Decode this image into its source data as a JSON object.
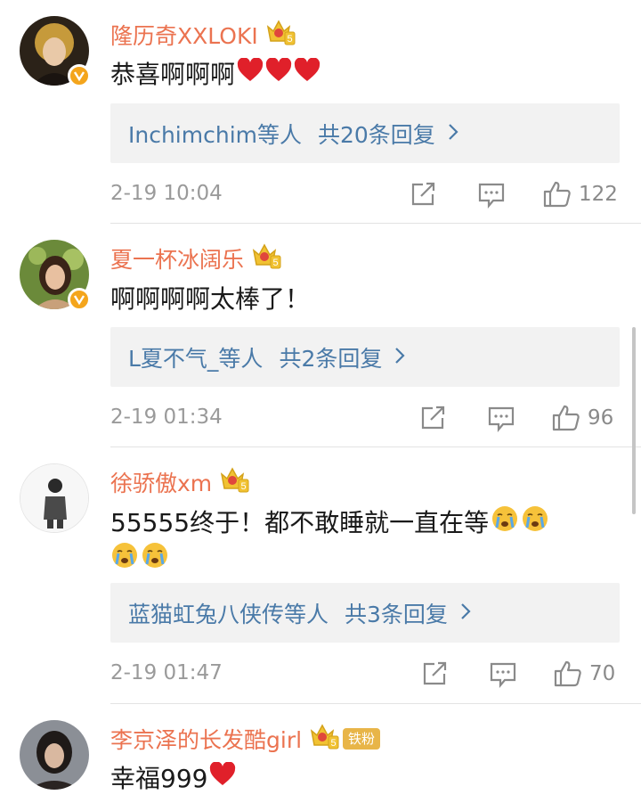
{
  "comments": [
    {
      "username": "隆历奇XXLOKI",
      "crown_level": "5",
      "text": "恭喜啊啊啊",
      "reply_users": "Inchimchim等人",
      "reply_count": "共20条回复",
      "time": "2-19 10:04",
      "likes": "122"
    },
    {
      "username": "夏一杯冰阔乐",
      "crown_level": "5",
      "text": "啊啊啊啊太棒了！",
      "reply_users": "L夏不气_等人",
      "reply_count": "共2条回复",
      "time": "2-19 01:34",
      "likes": "96"
    },
    {
      "username": "徐骄傲xm",
      "crown_level": "5",
      "text": "55555终于！都不敢睡就一直在等",
      "reply_users": "蓝猫虹兔八侠传等人",
      "reply_count": "共3条回复",
      "time": "2-19 01:47",
      "likes": "70"
    },
    {
      "username": "李京泽的长发酷girl",
      "crown_level": "5",
      "fan_tag": "铁粉",
      "text": "幸福999"
    }
  ],
  "colors": {
    "username": "#eb7350",
    "reply_link": "#4a7aa8",
    "meta": "#9a9a9a",
    "verified_badge": "#f4a51c",
    "heart": "#e0202a"
  },
  "icons": [
    "verified-badge-icon",
    "crown-icon",
    "heart-emoji-icon",
    "crying-emoji-icon",
    "chevron-right-icon",
    "share-icon",
    "comment-icon",
    "like-icon"
  ]
}
